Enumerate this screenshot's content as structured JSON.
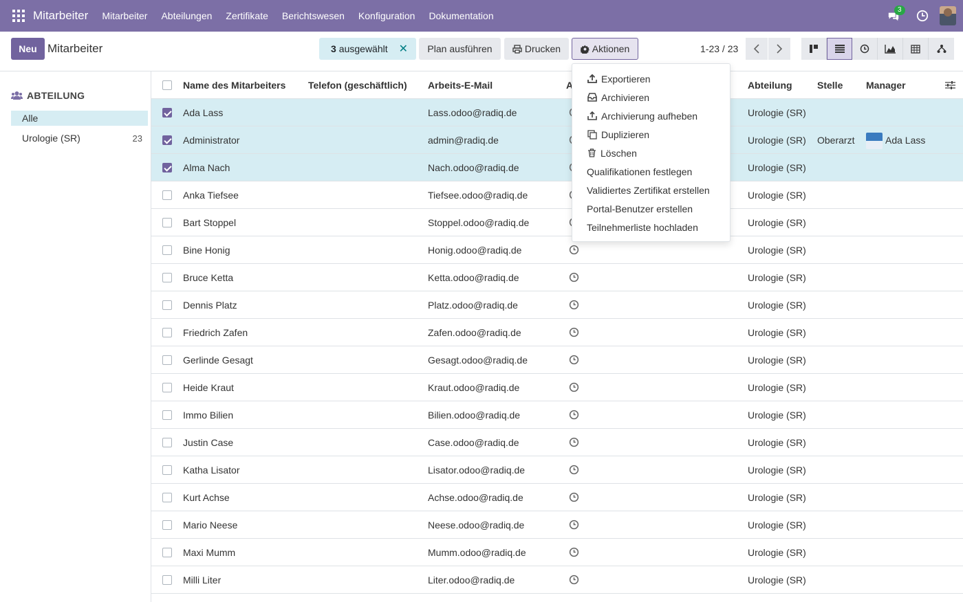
{
  "navbar": {
    "brand": "Mitarbeiter",
    "menu": [
      "Mitarbeiter",
      "Abteilungen",
      "Zertifikate",
      "Berichtswesen",
      "Konfiguration",
      "Dokumentation"
    ],
    "chat_badge": "3"
  },
  "control": {
    "new_label": "Neu",
    "title": "Mitarbeiter",
    "selected_count": "3",
    "selected_label": "ausgewählt",
    "plan_label": "Plan ausführen",
    "print_label": "Drucken",
    "actions_label": "Aktionen",
    "pager": "1-23 / 23"
  },
  "sidebar": {
    "heading": "ABTEILUNG",
    "items": [
      {
        "label": "Alle",
        "count": ""
      },
      {
        "label": "Urologie (SR)",
        "count": "23"
      }
    ]
  },
  "table": {
    "headers": {
      "name": "Name des Mitarbeiters",
      "phone": "Telefon (geschäftlich)",
      "email": "Arbeits-E-Mail",
      "activity": "A",
      "department": "Abteilung",
      "job": "Stelle",
      "manager": "Manager"
    },
    "rows": [
      {
        "name": "Ada Lass",
        "email": "Lass.odoo@radiq.de",
        "department": "Urologie (SR)",
        "job": "",
        "manager": "",
        "selected": true
      },
      {
        "name": "Administrator",
        "email": "admin@radiq.de",
        "department": "Urologie (SR)",
        "job": "Oberarzt",
        "manager": "Ada Lass",
        "selected": true
      },
      {
        "name": "Alma Nach",
        "email": "Nach.odoo@radiq.de",
        "department": "Urologie (SR)",
        "job": "",
        "manager": "",
        "selected": true
      },
      {
        "name": "Anka Tiefsee",
        "email": "Tiefsee.odoo@radiq.de",
        "department": "Urologie (SR)",
        "job": "",
        "manager": "",
        "selected": false
      },
      {
        "name": "Bart Stoppel",
        "email": "Stoppel.odoo@radiq.de",
        "department": "Urologie (SR)",
        "job": "",
        "manager": "",
        "selected": false
      },
      {
        "name": "Bine Honig",
        "email": "Honig.odoo@radiq.de",
        "department": "Urologie (SR)",
        "job": "",
        "manager": "",
        "selected": false
      },
      {
        "name": "Bruce Ketta",
        "email": "Ketta.odoo@radiq.de",
        "department": "Urologie (SR)",
        "job": "",
        "manager": "",
        "selected": false
      },
      {
        "name": "Dennis Platz",
        "email": "Platz.odoo@radiq.de",
        "department": "Urologie (SR)",
        "job": "",
        "manager": "",
        "selected": false
      },
      {
        "name": "Friedrich Zafen",
        "email": "Zafen.odoo@radiq.de",
        "department": "Urologie (SR)",
        "job": "",
        "manager": "",
        "selected": false
      },
      {
        "name": "Gerlinde Gesagt",
        "email": "Gesagt.odoo@radiq.de",
        "department": "Urologie (SR)",
        "job": "",
        "manager": "",
        "selected": false
      },
      {
        "name": "Heide Kraut",
        "email": "Kraut.odoo@radiq.de",
        "department": "Urologie (SR)",
        "job": "",
        "manager": "",
        "selected": false
      },
      {
        "name": "Immo Bilien",
        "email": "Bilien.odoo@radiq.de",
        "department": "Urologie (SR)",
        "job": "",
        "manager": "",
        "selected": false
      },
      {
        "name": "Justin Case",
        "email": "Case.odoo@radiq.de",
        "department": "Urologie (SR)",
        "job": "",
        "manager": "",
        "selected": false
      },
      {
        "name": "Katha Lisator",
        "email": "Lisator.odoo@radiq.de",
        "department": "Urologie (SR)",
        "job": "",
        "manager": "",
        "selected": false
      },
      {
        "name": "Kurt Achse",
        "email": "Achse.odoo@radiq.de",
        "department": "Urologie (SR)",
        "job": "",
        "manager": "",
        "selected": false
      },
      {
        "name": "Mario Neese",
        "email": "Neese.odoo@radiq.de",
        "department": "Urologie (SR)",
        "job": "",
        "manager": "",
        "selected": false
      },
      {
        "name": "Maxi Mumm",
        "email": "Mumm.odoo@radiq.de",
        "department": "Urologie (SR)",
        "job": "",
        "manager": "",
        "selected": false
      },
      {
        "name": "Milli Liter",
        "email": "Liter.odoo@radiq.de",
        "department": "Urologie (SR)",
        "job": "",
        "manager": "",
        "selected": false
      }
    ]
  },
  "dropdown": {
    "items": [
      {
        "label": "Exportieren",
        "icon": "upload-icon"
      },
      {
        "label": "Archivieren",
        "icon": "inbox-icon"
      },
      {
        "label": "Archivierung aufheben",
        "icon": "unarchive-icon"
      },
      {
        "label": "Duplizieren",
        "icon": "copy-icon"
      },
      {
        "label": "Löschen",
        "icon": "trash-icon"
      },
      {
        "label": "Qualifikationen festlegen",
        "icon": ""
      },
      {
        "label": "Validiertes Zertifikat erstellen",
        "icon": ""
      },
      {
        "label": "Portal-Benutzer erstellen",
        "icon": ""
      },
      {
        "label": "Teilnehmerliste hochladen",
        "icon": ""
      }
    ]
  }
}
